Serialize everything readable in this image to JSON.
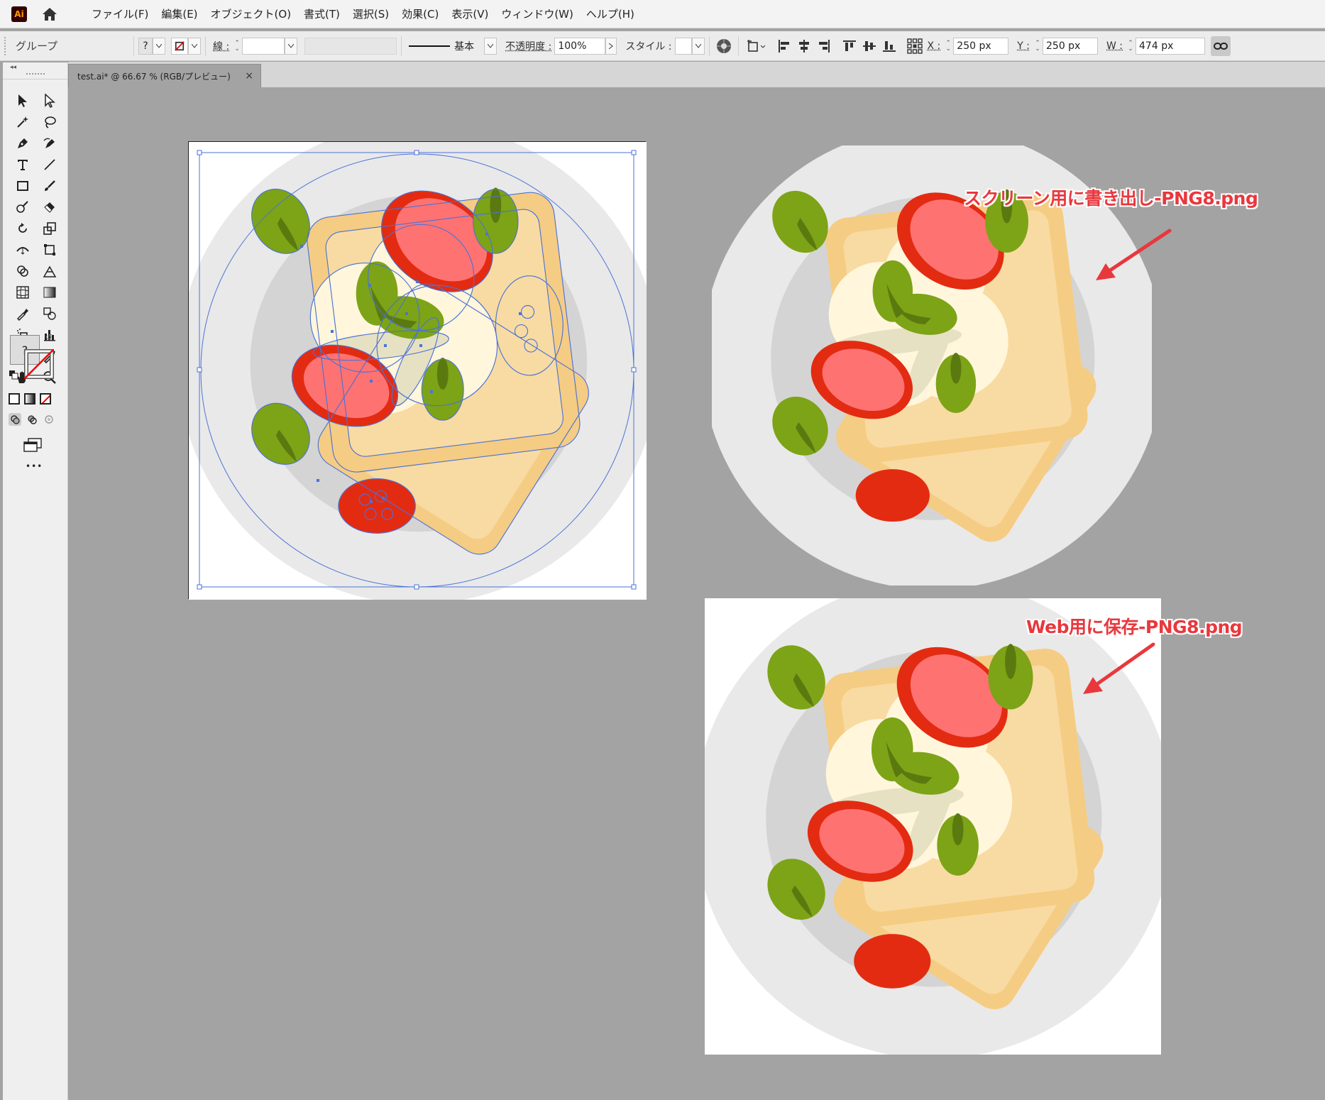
{
  "app": {
    "logo": "Ai"
  },
  "menu": [
    "ファイル(F)",
    "編集(E)",
    "オブジェクト(O)",
    "書式(T)",
    "選択(S)",
    "効果(C)",
    "表示(V)",
    "ウィンドウ(W)",
    "ヘルプ(H)"
  ],
  "control": {
    "selection_type": "グループ",
    "fill_value": "?",
    "stroke_label": "線 :",
    "brush_label": "基本",
    "opacity_label": "不透明度 :",
    "opacity_value": "100%",
    "style_label": "スタイル :",
    "x_label": "X :",
    "x_value": "250 px",
    "y_label": "Y :",
    "y_value": "250 px",
    "w_label": "W :",
    "w_value": "474 px"
  },
  "document_tab": {
    "title": "test.ai* @ 66.67 % (RGB/プレビュー)",
    "close": "×"
  },
  "toolbar": {
    "fill_swatch": "?",
    "more": "•••"
  },
  "annotations": {
    "export_screens": "スクリーン用に書き出し-PNG8.png",
    "save_for_web": "Web用に保存-PNG8.png"
  },
  "colors": {
    "arrow": "#e8383d",
    "selection": "#4a72d8",
    "bread": "#f8d8a0",
    "tomato": "#e32b12",
    "leaf": "#7da317"
  }
}
